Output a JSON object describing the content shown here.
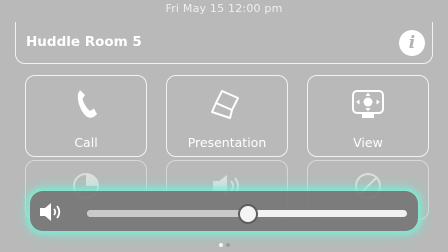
{
  "status_bar": {
    "datetime": "Fri May 15  12:00 pm"
  },
  "header": {
    "room_name": "Huddle Room 5",
    "info_icon": "info-icon"
  },
  "tiles": [
    {
      "label": "Call",
      "icon": "phone-icon"
    },
    {
      "label": "Presentation",
      "icon": "laptop-icon"
    },
    {
      "label": "View",
      "icon": "camera-view-icon"
    }
  ],
  "tiles_row2": [
    {
      "icon": "pie-icon"
    },
    {
      "icon": "speaker-icon"
    },
    {
      "icon": "mute-mic-icon"
    }
  ],
  "volume": {
    "icon": "speaker-icon",
    "level": 0.5
  },
  "pagination": {
    "pages": 2,
    "current": 1
  },
  "colors": {
    "background": "#b9b9b9",
    "glow": "#78f0d7",
    "panel": "#767676"
  }
}
